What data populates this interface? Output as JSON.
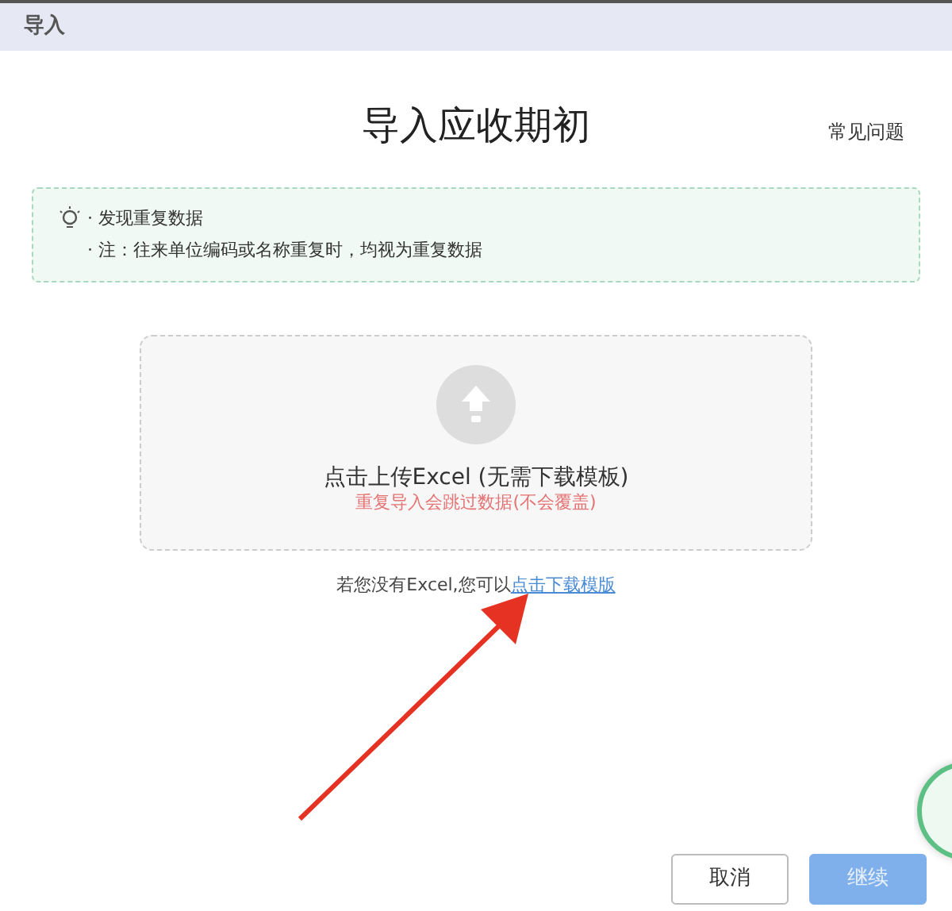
{
  "window": {
    "title": "导入"
  },
  "heading": "导入应收期初",
  "help_link": "常见问题",
  "notice": {
    "lines": [
      "· 发现重复数据",
      "· 注：往来单位编码或名称重复时，均视为重复数据"
    ]
  },
  "upload": {
    "label": "点击上传Excel (无需下载模板)",
    "warning": "重复导入会跳过数据(不会覆盖)"
  },
  "template_hint": {
    "text": "若您没有Excel,您可以",
    "link": "点击下载模版"
  },
  "buttons": [
    {
      "label": "取消",
      "kind": "secondary",
      "disabled": false
    },
    {
      "label": "继续",
      "kind": "primary",
      "disabled": true
    }
  ]
}
